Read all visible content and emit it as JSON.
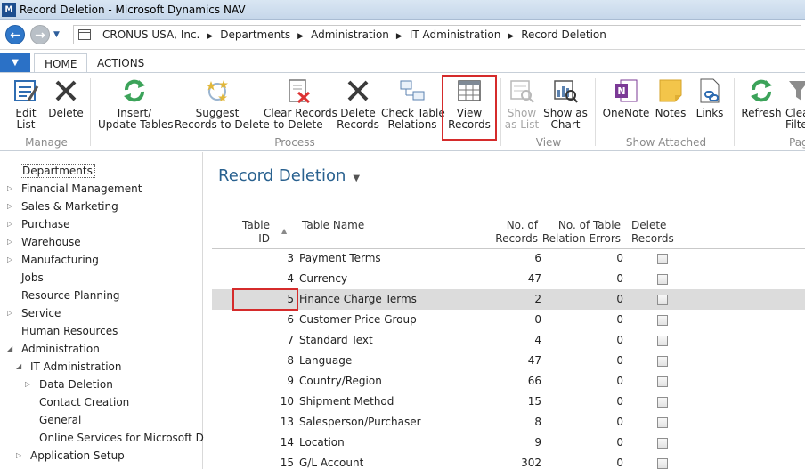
{
  "window": {
    "title": "Record Deletion - Microsoft Dynamics NAV",
    "logo": "M"
  },
  "nav": {
    "back_icon": "arrow-left-icon",
    "forward_icon": "arrow-right-icon",
    "crumbs": [
      "CRONUS USA, Inc.",
      "Departments",
      "Administration",
      "IT Administration",
      "Record Deletion"
    ]
  },
  "ribbon_tabs": {
    "app_menu": "▼",
    "home": "HOME",
    "actions": "ACTIONS"
  },
  "ribbon": {
    "edit_list": "Edit\nList",
    "delete": "Delete",
    "insert_update_tables": "Insert/\nUpdate Tables",
    "suggest_records": "Suggest\nRecords to Delete",
    "clear_records": "Clear Records\nto Delete",
    "delete_records": "Delete\nRecords",
    "check_table_relations": "Check Table\nRelations",
    "view_records": "View\nRecords",
    "show_as_list": "Show\nas List",
    "show_as_chart": "Show as\nChart",
    "onenote": "OneNote",
    "notes": "Notes",
    "links": "Links",
    "refresh": "Refresh",
    "clear_filter": "Clea\nFilte",
    "groups": {
      "manage": "Manage",
      "process": "Process",
      "view": "View",
      "show_attached": "Show Attached",
      "page": "Pag"
    }
  },
  "left_nav": {
    "items": [
      "Departments",
      "Financial Management",
      "Sales & Marketing",
      "Purchase",
      "Warehouse",
      "Manufacturing",
      "Jobs",
      "Resource Planning",
      "Service",
      "Human Resources",
      "Administration",
      "IT Administration",
      "Data Deletion",
      "Contact Creation",
      "General",
      "Online Services for Microsoft Dy...",
      "Application Setup"
    ]
  },
  "main": {
    "title": "Record Deletion",
    "columns": {
      "table_id": "Table\nID",
      "table_name": "Table Name",
      "no_of_records": "No. of\nRecords",
      "relation_errors": "No. of Table\nRelation Errors",
      "delete_records": "Delete\nRecords"
    },
    "rows": [
      {
        "id": "3",
        "name": "Payment Terms",
        "records": "6",
        "errors": "0"
      },
      {
        "id": "4",
        "name": "Currency",
        "records": "47",
        "errors": "0"
      },
      {
        "id": "5",
        "name": "Finance Charge Terms",
        "records": "2",
        "errors": "0"
      },
      {
        "id": "6",
        "name": "Customer Price Group",
        "records": "0",
        "errors": "0"
      },
      {
        "id": "7",
        "name": "Standard Text",
        "records": "4",
        "errors": "0"
      },
      {
        "id": "8",
        "name": "Language",
        "records": "47",
        "errors": "0"
      },
      {
        "id": "9",
        "name": "Country/Region",
        "records": "66",
        "errors": "0"
      },
      {
        "id": "10",
        "name": "Shipment Method",
        "records": "15",
        "errors": "0"
      },
      {
        "id": "13",
        "name": "Salesperson/Purchaser",
        "records": "8",
        "errors": "0"
      },
      {
        "id": "14",
        "name": "Location",
        "records": "9",
        "errors": "0"
      },
      {
        "id": "15",
        "name": "G/L Account",
        "records": "302",
        "errors": "0"
      }
    ]
  },
  "colors": {
    "accent": "#2b71c6",
    "highlight": "#d52b2b",
    "title": "#29618f"
  }
}
